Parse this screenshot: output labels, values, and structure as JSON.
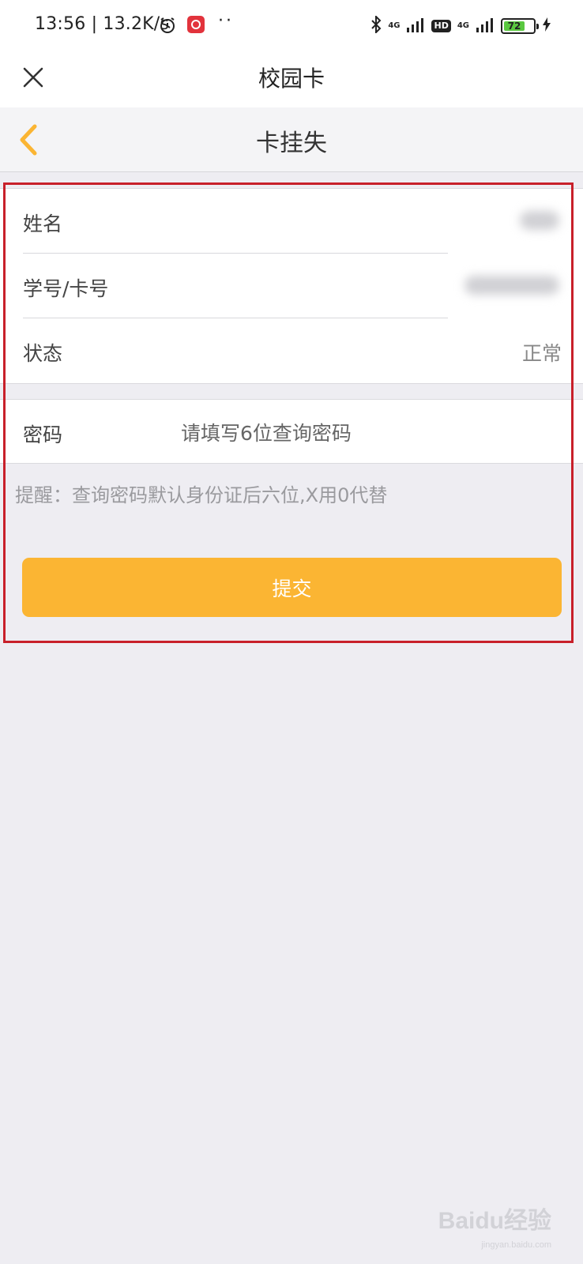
{
  "status_bar": {
    "time_speed": "13:56 | 13.2K/s",
    "signal_1_tag": "4G",
    "hd_badge": "HD",
    "signal_2_tag": "4G",
    "battery_level": "72"
  },
  "app_header": {
    "title": "校园卡"
  },
  "nav": {
    "title": "卡挂失"
  },
  "form": {
    "name_label": "姓名",
    "student_id_label": "学号/卡号",
    "status_label": "状态",
    "status_value": "正常",
    "password_label": "密码",
    "password_placeholder": "请填写6位查询密码",
    "password_value": ""
  },
  "hint": "提醒：查询密码默认身份证后六位,X用0代替",
  "submit_label": "提交",
  "watermark": {
    "brand": "Baidu经验",
    "sub": "jingyan.baidu.com"
  },
  "colors": {
    "accent": "#fbb533",
    "highlight_border": "#c8202a",
    "page_bg": "#eeedf2"
  }
}
